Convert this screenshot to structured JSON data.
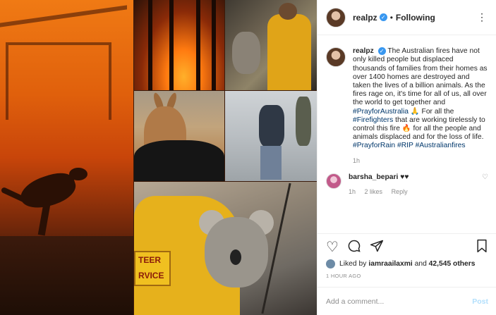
{
  "header": {
    "username": "realpz",
    "separator": "•",
    "follow_state": "Following",
    "more_icon": "⋮"
  },
  "caption": {
    "username": "realpz",
    "segments": [
      {
        "t": "The Australian fires have not only killed people but displaced thousands of families from their homes as over 1400 homes are destroyed and taken the lives of a billion animals. As the fires rage on, it's time for all of us, all over the world to get together and ",
        "tag": false
      },
      {
        "t": "#PrayforAustralia",
        "tag": true
      },
      {
        "t": " 🙏 For all the ",
        "tag": false
      },
      {
        "t": "#Firefighters",
        "tag": true
      },
      {
        "t": " that are working tirelessly to control this fire 🔥 for all the people and animals displaced and for the loss of life. ",
        "tag": false
      },
      {
        "t": "#PrayforRain",
        "tag": true
      },
      {
        "t": " ",
        "tag": false
      },
      {
        "t": "#RIP",
        "tag": true
      },
      {
        "t": " ",
        "tag": false
      },
      {
        "t": "#Australianfires",
        "tag": true
      }
    ],
    "time": "1h"
  },
  "comment": {
    "username": "barsha_bepari",
    "text": "♥♥",
    "time": "1h",
    "likes": "2 likes",
    "reply": "Reply"
  },
  "photo_text": {
    "patch": "TEER\nRVICE"
  },
  "likes": {
    "prefix": "Liked by ",
    "user": "iamraailaxmi",
    "mid": " and ",
    "count": "42,545 others"
  },
  "timestamp": "1 HOUR AGO",
  "add_comment": {
    "placeholder": "Add a comment...",
    "post_label": "Post"
  },
  "colors": {
    "link": "#00376b",
    "verified": "#3897f0",
    "post_disabled": "#b2dffc"
  }
}
